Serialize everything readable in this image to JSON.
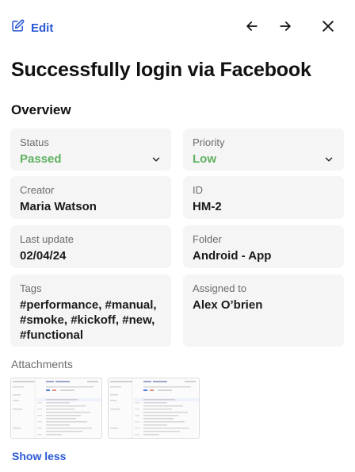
{
  "toolbar": {
    "edit_label": "Edit",
    "edit_icon": "pencil-square-icon",
    "prev_icon": "arrow-left-icon",
    "next_icon": "arrow-right-icon",
    "close_icon": "close-icon"
  },
  "title": "Successfully login via Facebook",
  "overview": {
    "heading": "Overview",
    "status": {
      "label": "Status",
      "value": "Passed"
    },
    "priority": {
      "label": "Priority",
      "value": "Low"
    },
    "creator": {
      "label": "Creator",
      "value": "Maria Watson"
    },
    "id": {
      "label": "ID",
      "value": "HM-2"
    },
    "last_update": {
      "label": "Last update",
      "value": "02/04/24"
    },
    "folder": {
      "label": "Folder",
      "value": "Android - App"
    },
    "tags": {
      "label": "Tags",
      "value": "#performance, #manual, #smoke, #kickoff, #new, #functional"
    },
    "assigned_to": {
      "label": "Assigned to",
      "value": "Alex O’brien"
    }
  },
  "attachments": {
    "heading": "Attachments",
    "count": 2
  },
  "show_less_label": "Show less",
  "colors": {
    "accent": "#2a59d6",
    "status_passed": "#5fb15f",
    "card_bg": "#f5f5f6"
  }
}
